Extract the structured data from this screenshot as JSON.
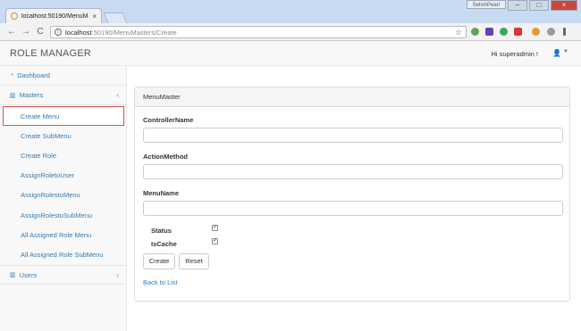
{
  "browser": {
    "tab_title": "localhost:50190/MenuMa",
    "tab_close": "×",
    "user_badge": "SelvinPearl",
    "win_min": "–",
    "win_max": "□",
    "win_close": "×",
    "back": "←",
    "forward": "→",
    "reload": "C",
    "url_host": "localhost",
    "url_path": ":50190/MenuMasters/Create",
    "bookmark_star": "☆"
  },
  "header": {
    "brand": "ROLE MANAGER",
    "greeting": "Hi superadmin !",
    "user_icon": "👤",
    "caret": "▼"
  },
  "sidebar": {
    "dashboard": "Dashboard",
    "masters": "Masters",
    "users": "Users",
    "collapse_arrow": "‹",
    "items": [
      "Create Menu",
      "Create SubMenu",
      "Create Role",
      "AssignRoletoUser",
      "AssignRolestoMenu",
      "AssignRolestoSubMenu",
      "All Assigned Role Menu",
      "All Assigned Role SubMenu"
    ]
  },
  "form": {
    "heading": "MenuMaster",
    "controller_label": "ControllerName",
    "action_label": "ActionMethod",
    "menuname_label": "MenuName",
    "status_label": "Status",
    "iscache_label": "IsCache",
    "check_mark": "✓",
    "create_button": "Create",
    "reset_button": "Reset",
    "back_link": "Back to List"
  }
}
